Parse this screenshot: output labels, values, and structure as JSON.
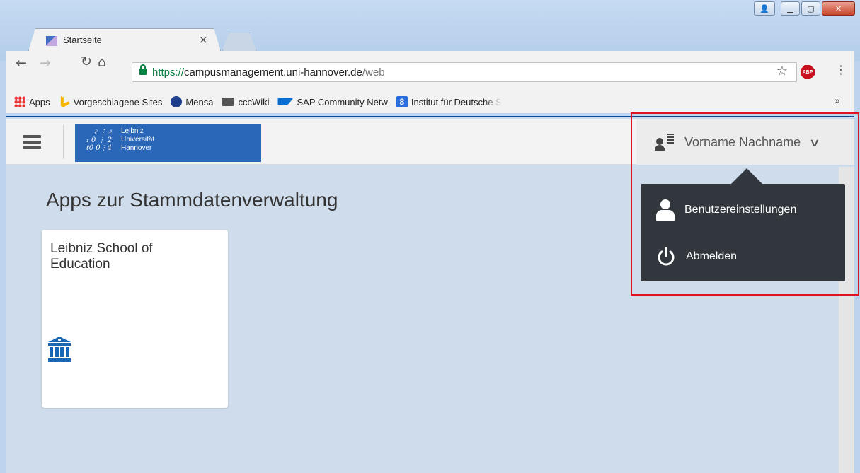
{
  "browser": {
    "tab_title": "Startseite",
    "tab_close": "×",
    "url_scheme": "https://",
    "url_host": "campusmanagement.uni-hannover.de",
    "url_path": "/web",
    "abp_label": "ABP",
    "bookmarks": {
      "apps": "Apps",
      "vorgeschlagene": "Vorgeschlagene Sites",
      "mensa": "Mensa",
      "cccwiki": "cccWiki",
      "sap": "SAP Community Netw",
      "institut": "Institut für Deutsche S",
      "more": "»"
    }
  },
  "header": {
    "logo_mark": "ℓ ⋮ ℓ\n₁ 0 ⋮ 2\nℓ0 0⋮4",
    "logo_line1": "Leibniz",
    "logo_line2": "Universität",
    "logo_line3": "Hannover",
    "user_name": "Vorname Nachname"
  },
  "main": {
    "title": "Apps zur Stammdatenverwaltung",
    "tiles": [
      {
        "title": "Leibniz School of Education",
        "icon": "institution-icon"
      }
    ]
  },
  "dropdown": {
    "items": [
      {
        "label": "Benutzereinstellungen",
        "icon": "person-icon"
      },
      {
        "label": "Abmelden",
        "icon": "power-icon"
      }
    ]
  },
  "colors": {
    "page_bg": "#cfdceb",
    "dropdown_bg": "#31373d",
    "highlight": "#e0141e",
    "brand_blue": "#2a67b8",
    "tile_icon": "#1767b5"
  }
}
